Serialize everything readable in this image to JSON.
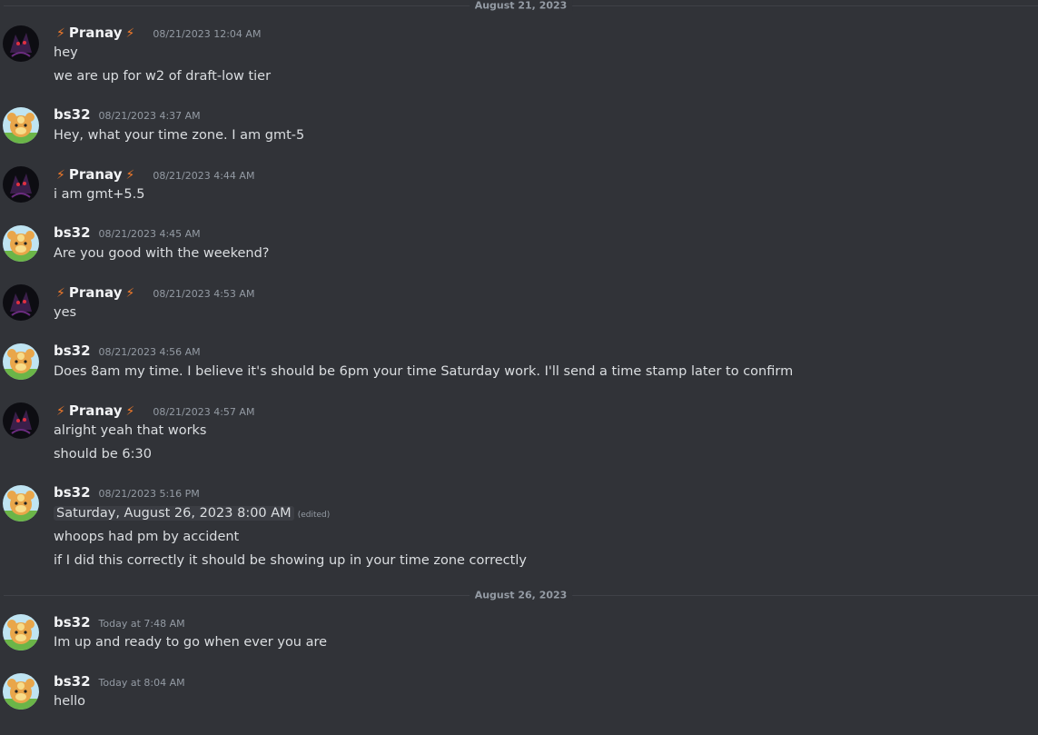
{
  "dividers": [
    "August 21, 2023",
    "August 26, 2023"
  ],
  "users": {
    "pranay": "Pranay",
    "bs32": "bs32"
  },
  "bolt": "⚡",
  "messages": [
    {
      "author": "Pranay",
      "time": "08/21/2023 12:04 AM",
      "lines": [
        "hey",
        "we are up for w2 of draft-low tier"
      ]
    },
    {
      "author": "bs32",
      "time": "08/21/2023 4:37 AM",
      "lines": [
        "Hey, what your time zone. I am gmt-5"
      ]
    },
    {
      "author": "Pranay",
      "time": "08/21/2023 4:44 AM",
      "lines": [
        "i am gmt+5.5"
      ]
    },
    {
      "author": "bs32",
      "time": "08/21/2023 4:45 AM",
      "lines": [
        "Are you good with the weekend?"
      ]
    },
    {
      "author": "Pranay",
      "time": "08/21/2023 4:53 AM",
      "lines": [
        "yes"
      ]
    },
    {
      "author": "bs32",
      "time": "08/21/2023 4:56 AM",
      "lines": [
        "Does 8am my time. I believe it's should be 6pm your time Saturday work. I'll send a time stamp later to confirm"
      ]
    },
    {
      "author": "Pranay",
      "time": "08/21/2023 4:57 AM",
      "lines": [
        "alright yeah that works",
        "should be 6:30"
      ]
    },
    {
      "author": "bs32",
      "time": "08/21/2023 5:16 PM",
      "timestamp_chip": "Saturday, August 26, 2023 8:00 AM",
      "edited": "(edited)",
      "lines": [
        "whoops had pm by accident",
        "if I did this correctly it should be showing up in your time zone correctly"
      ]
    },
    {
      "author": "bs32",
      "time": "Today at 7:48 AM",
      "lines": [
        "Im up and ready to go when ever you are"
      ]
    },
    {
      "author": "bs32",
      "time": "Today at 8:04 AM",
      "lines": [
        "hello"
      ]
    }
  ],
  "colors": {
    "background": "#313338",
    "bolt": "#f47b2a",
    "muted": "#949ba4",
    "text": "#dbdee1"
  }
}
